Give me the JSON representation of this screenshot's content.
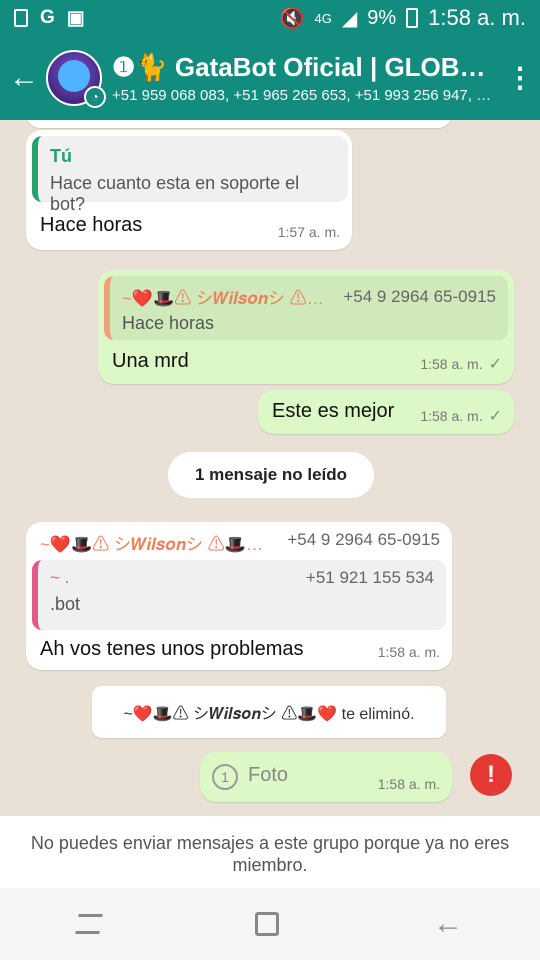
{
  "status_bar": {
    "left_icons": [
      "notification-icon",
      "google-icon",
      "image-icon"
    ],
    "signal": "4G",
    "battery": "9%",
    "time": "1:58 a. m."
  },
  "header": {
    "title": "❶🐈 GataBot Oficial | GLOB…",
    "subtitle": "+51 959 068 083, +51 965 265 653, +51 993 256 947, +…",
    "avatar_label": "GATABOT"
  },
  "messages": [
    {
      "quote_name": "Tú",
      "quote_text": "Hace cuanto esta en soporte el bot?",
      "text": "Hace horas",
      "time": "1:57 a. m."
    },
    {
      "quote_name": "~❤️🎩⚠ シ𝑾𝒊𝒍𝒔𝒐𝒏シ ⚠…",
      "quote_phone": "+54 9 2964 65-0915",
      "quote_text": "Hace horas",
      "text": "Una mrd",
      "time": "1:58 a. m.",
      "tick": "✓"
    },
    {
      "text": "Este es mejor",
      "time": "1:58 a. m.",
      "tick": "✓"
    },
    {
      "sender": "~❤️🎩⚠ シ𝑾𝒊𝒍𝒔𝒐𝒏シ ⚠🎩…",
      "sender_phone": "+54 9 2964 65-0915",
      "quote_name": "~ .",
      "quote_phone": "+51 921 155 534",
      "quote_text": ".bot",
      "text": "Ah vos tenes unos problemas",
      "time": "1:58 a. m."
    },
    {
      "text": "Foto",
      "time": "1:58 a. m."
    }
  ],
  "unread_label": "1 mensaje no leído",
  "system_message": "~❤️🎩⚠ シ𝑾𝒊𝒍𝒔𝒐𝒏シ ⚠🎩❤️ te eliminó.",
  "notice": "No puedes enviar mensajes a este grupo porque ya no eres miembro.",
  "colors": {
    "header": "#128c7e",
    "outgoing_bubble": "#dcf8c6",
    "incoming_bubble": "#ffffff",
    "error": "#e53935"
  }
}
